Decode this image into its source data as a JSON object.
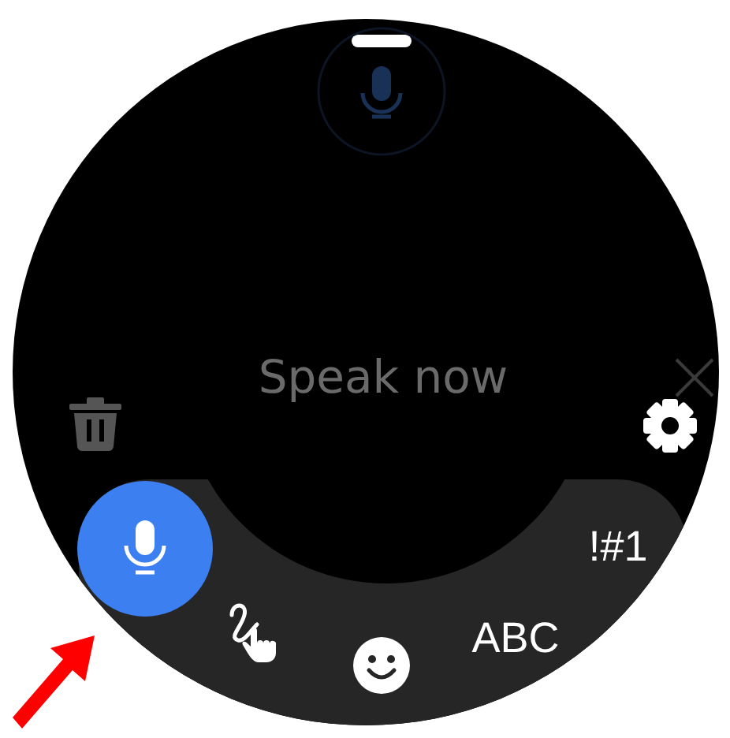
{
  "prompt": {
    "text": "Speak now"
  },
  "input_modes": [
    {
      "kind": "voice",
      "selected": true
    },
    {
      "kind": "handwriting",
      "selected": false
    },
    {
      "kind": "emoji",
      "selected": false
    },
    {
      "kind": "keyboard",
      "label": "ABC",
      "selected": false
    },
    {
      "kind": "symbols",
      "label": "!#1",
      "selected": false
    }
  ]
}
